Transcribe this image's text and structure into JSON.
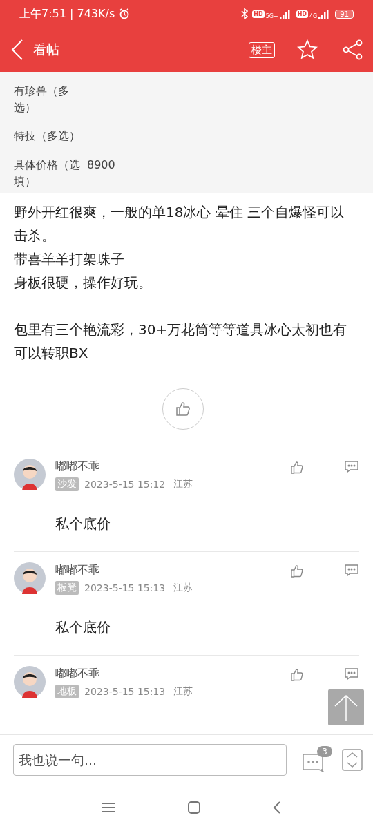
{
  "status_bar": {
    "time": "上午7:51 | 743K/s",
    "network_labels": [
      {
        "hd": "HD",
        "gen": "5G+"
      },
      {
        "hd": "HD",
        "gen": "4G"
      }
    ],
    "battery": "91"
  },
  "header": {
    "title": "看帖",
    "owner_button": "楼主"
  },
  "info_rows": [
    {
      "label": "有珍兽（多选）"
    },
    {
      "label": "特技（多选）"
    },
    {
      "label": "具体价格（选填）",
      "value": "8900"
    }
  ],
  "post": {
    "paragraphs": [
      [
        "野外开红很爽，一般的单18冰心 晕住 三个自爆怪可以击杀。",
        "带喜羊羊打架珠子",
        "身板很硬，操作好玩。"
      ],
      [
        "包里有三个艳流彩，30+万花筒等等道具冰心太初也有可以转职BX"
      ]
    ]
  },
  "comments": [
    {
      "user": "嘟嘟不乖",
      "floor": "沙发",
      "time": "2023-5-15 15:12",
      "location": "江苏",
      "text": "私个底价"
    },
    {
      "user": "嘟嘟不乖",
      "floor": "板凳",
      "time": "2023-5-15 15:13",
      "location": "江苏",
      "text": "私个底价"
    },
    {
      "user": "嘟嘟不乖",
      "floor": "地板",
      "time": "2023-5-15 15:13",
      "location": "江苏"
    }
  ],
  "reply_bar": {
    "placeholder": "我也说一句...",
    "comment_count": "3"
  }
}
